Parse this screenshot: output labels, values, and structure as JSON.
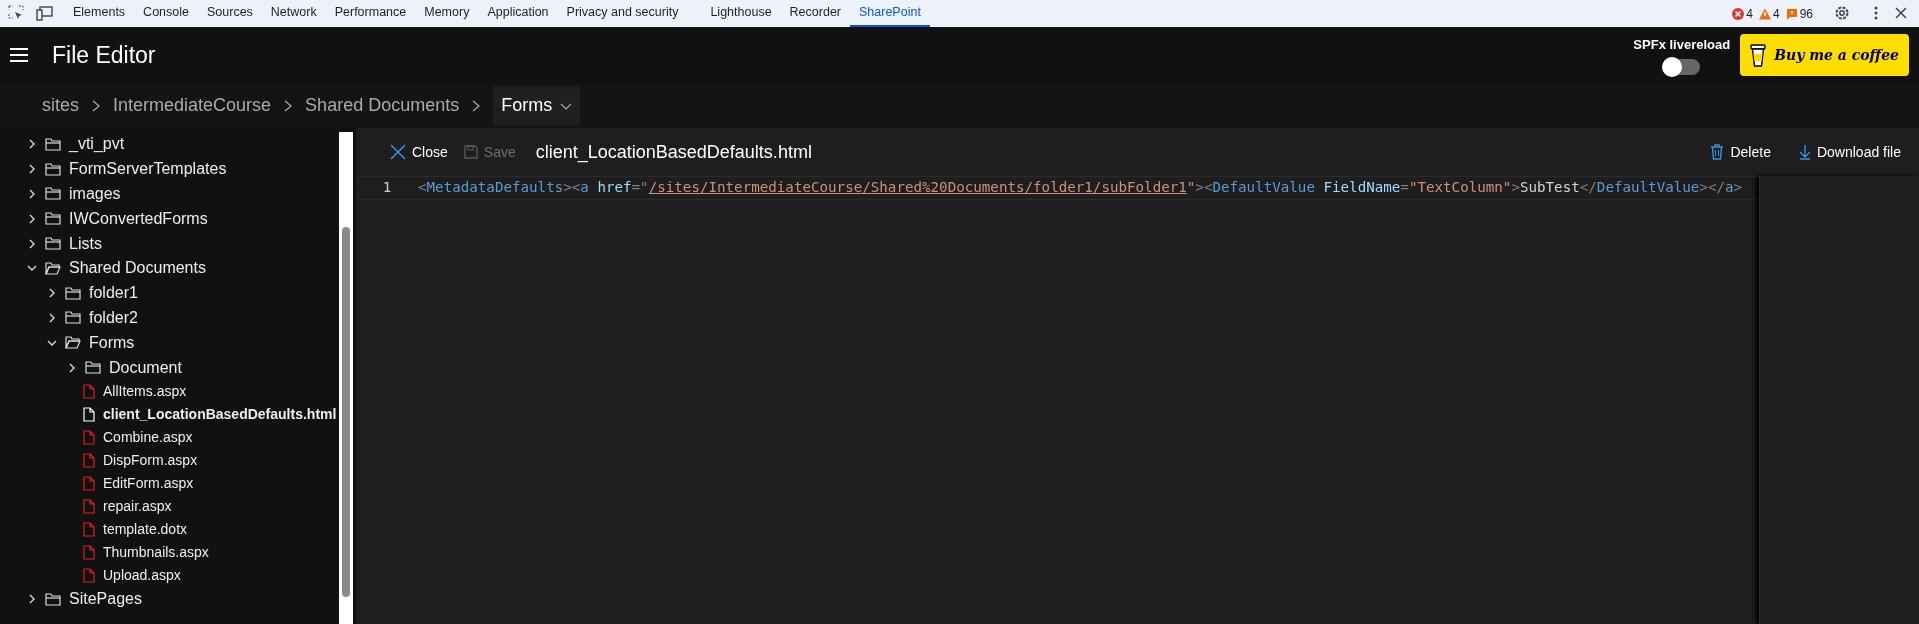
{
  "devtools": {
    "tabs": [
      {
        "label": "Elements",
        "selected": false
      },
      {
        "label": "Console",
        "selected": false
      },
      {
        "label": "Sources",
        "selected": false
      },
      {
        "label": "Network",
        "selected": false
      },
      {
        "label": "Performance",
        "selected": false
      },
      {
        "label": "Memory",
        "selected": false
      },
      {
        "label": "Application",
        "selected": false
      },
      {
        "label": "Privacy and security",
        "selected": false
      },
      {
        "label": "Lighthouse",
        "selected": false
      },
      {
        "label": "Recorder",
        "selected": false
      },
      {
        "label": "SharePoint",
        "selected": true
      }
    ],
    "counters": [
      {
        "kind": "error",
        "count": "4"
      },
      {
        "kind": "warning",
        "count": "4"
      },
      {
        "kind": "info",
        "count": "96"
      }
    ]
  },
  "header": {
    "title": "File Editor",
    "livereload": {
      "label": "SPFx livereload",
      "on": false
    },
    "coffee_button": "Buy me a coffee"
  },
  "breadcrumb": [
    {
      "label": "sites",
      "current": false
    },
    {
      "label": "IntermediateCourse",
      "current": false
    },
    {
      "label": "Shared Documents",
      "current": false
    },
    {
      "label": "Forms",
      "current": true
    }
  ],
  "tree": [
    {
      "kind": "folder",
      "label": "_vti_pvt",
      "expanded": false
    },
    {
      "kind": "folder",
      "label": "FormServerTemplates",
      "expanded": false
    },
    {
      "kind": "folder",
      "label": "images",
      "expanded": false
    },
    {
      "kind": "folder",
      "label": "IWConvertedForms",
      "expanded": false
    },
    {
      "kind": "folder",
      "label": "Lists",
      "expanded": false
    },
    {
      "kind": "folder",
      "label": "Shared Documents",
      "expanded": true,
      "children": [
        {
          "kind": "folder",
          "label": "folder1",
          "expanded": false
        },
        {
          "kind": "folder",
          "label": "folder2",
          "expanded": false
        },
        {
          "kind": "folder",
          "label": "Forms",
          "expanded": true,
          "children": [
            {
              "kind": "folder",
              "label": "Document",
              "expanded": false
            },
            {
              "kind": "file",
              "label": "AllItems.aspx",
              "selected": false
            },
            {
              "kind": "file",
              "label": "client_LocationBasedDefaults.html",
              "selected": true
            },
            {
              "kind": "file",
              "label": "Combine.aspx",
              "selected": false
            },
            {
              "kind": "file",
              "label": "DispForm.aspx",
              "selected": false
            },
            {
              "kind": "file",
              "label": "EditForm.aspx",
              "selected": false
            },
            {
              "kind": "file",
              "label": "repair.aspx",
              "selected": false
            },
            {
              "kind": "file",
              "label": "template.dotx",
              "selected": false
            },
            {
              "kind": "file",
              "label": "Thumbnails.aspx",
              "selected": false
            },
            {
              "kind": "file",
              "label": "Upload.aspx",
              "selected": false
            }
          ]
        }
      ]
    },
    {
      "kind": "folder",
      "label": "SitePages",
      "expanded": false
    }
  ],
  "editor": {
    "close": "Close",
    "save": {
      "label": "Save",
      "disabled": true
    },
    "file_name": "client_LocationBasedDefaults.html",
    "delete": "Delete",
    "download": "Download file",
    "lines": [
      {
        "number": "1",
        "tokens": [
          {
            "kind": "punct",
            "text": "<"
          },
          {
            "kind": "tag",
            "text": "MetadataDefaults"
          },
          {
            "kind": "punct",
            "text": "><"
          },
          {
            "kind": "tag",
            "text": "a"
          },
          {
            "kind": "attr",
            "text": " href"
          },
          {
            "kind": "punct",
            "text": "=\""
          },
          {
            "kind": "link",
            "text": "/sites/IntermediateCourse/Shared%20Documents/folder1/subFolder1"
          },
          {
            "kind": "string",
            "text": "\""
          },
          {
            "kind": "punct",
            "text": "><"
          },
          {
            "kind": "tag",
            "text": "DefaultValue"
          },
          {
            "kind": "attr",
            "text": " FieldName"
          },
          {
            "kind": "punct",
            "text": "="
          },
          {
            "kind": "string",
            "text": "\"TextColumn\""
          },
          {
            "kind": "punct",
            "text": ">"
          },
          {
            "kind": "text",
            "text": "SubTest"
          },
          {
            "kind": "punct",
            "text": "</"
          },
          {
            "kind": "tag",
            "text": "DefaultValue"
          },
          {
            "kind": "punct",
            "text": "></"
          },
          {
            "kind": "tag",
            "text": "a"
          },
          {
            "kind": "punct",
            "text": ">"
          }
        ]
      }
    ]
  }
}
